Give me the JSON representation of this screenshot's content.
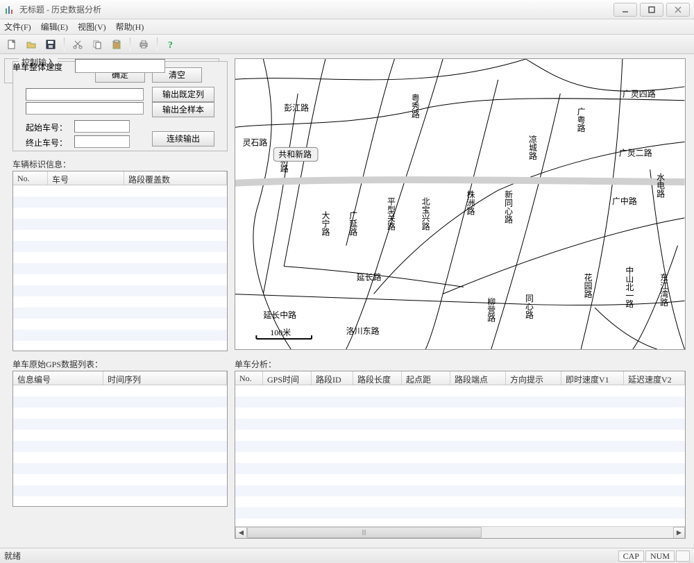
{
  "window": {
    "title": "无标题 - 历史数据分析"
  },
  "menu": {
    "file": "文件(F)",
    "edit": "编辑(E)",
    "view": "视图(V)",
    "help": "帮助(H)"
  },
  "control": {
    "legend": "控制输入",
    "ok": "确定",
    "clear": "清空",
    "out_preset": "输出既定列",
    "out_all": "输出全样本",
    "start_label": "起始车号：",
    "end_label": "终止车号：",
    "continuous": "连续输出",
    "input1": "",
    "input2": "",
    "start_value": "",
    "end_value": ""
  },
  "vehicle_table": {
    "legend": "车辆标识信息：",
    "cols": {
      "no": "No.",
      "veh": "车号",
      "cover": "路段覆盖数"
    }
  },
  "gps_table": {
    "legend": "单车原始GPS数据列表：",
    "cols": {
      "id": "信息编号",
      "time": "时间序列"
    }
  },
  "analysis": {
    "legend": "单车分析：",
    "cols": {
      "no": "No.",
      "gpstime": "GPS时间",
      "segid": "路段ID",
      "seglen": "路段长度",
      "startdist": "起点距",
      "endpoint": "路段端点",
      "dir": "方向提示",
      "v1": "即时速度V1",
      "v2": "延迟速度V2"
    }
  },
  "speed": {
    "label": "单车整体速度",
    "value": ""
  },
  "status": {
    "ready": "就绪",
    "cap": "CAP",
    "num": "NUM"
  },
  "map": {
    "tooltip": "共和新路",
    "scale": "100米",
    "roads": {
      "pengjiang": "彭江路",
      "lingshi": "灵石路",
      "yuexiu": "粤秀路",
      "guanglingsi": "广灵四路",
      "guangyue": "广粤路",
      "liangcheng": "凉城路",
      "guanglinger": "广灵二路",
      "shuidian": "水电路",
      "guangzhong": "广中路",
      "xintongxin": "新同心路",
      "zhuzhou": "株洲路",
      "beibao": "北宝兴路",
      "pingxingguan": "平型关路",
      "guangyan": "广延路",
      "daning": "大宁路",
      "yanchang": "延长路",
      "yanchangzhong": "延长中路",
      "luochuandong": "洛川东路",
      "liuying": "柳营路",
      "tongxin": "同心路",
      "huayuan": "花园路",
      "zhongshanbeiyi": "中山北一路",
      "dongjiangwan": "东江湾路",
      "xinlu": "新路"
    }
  }
}
